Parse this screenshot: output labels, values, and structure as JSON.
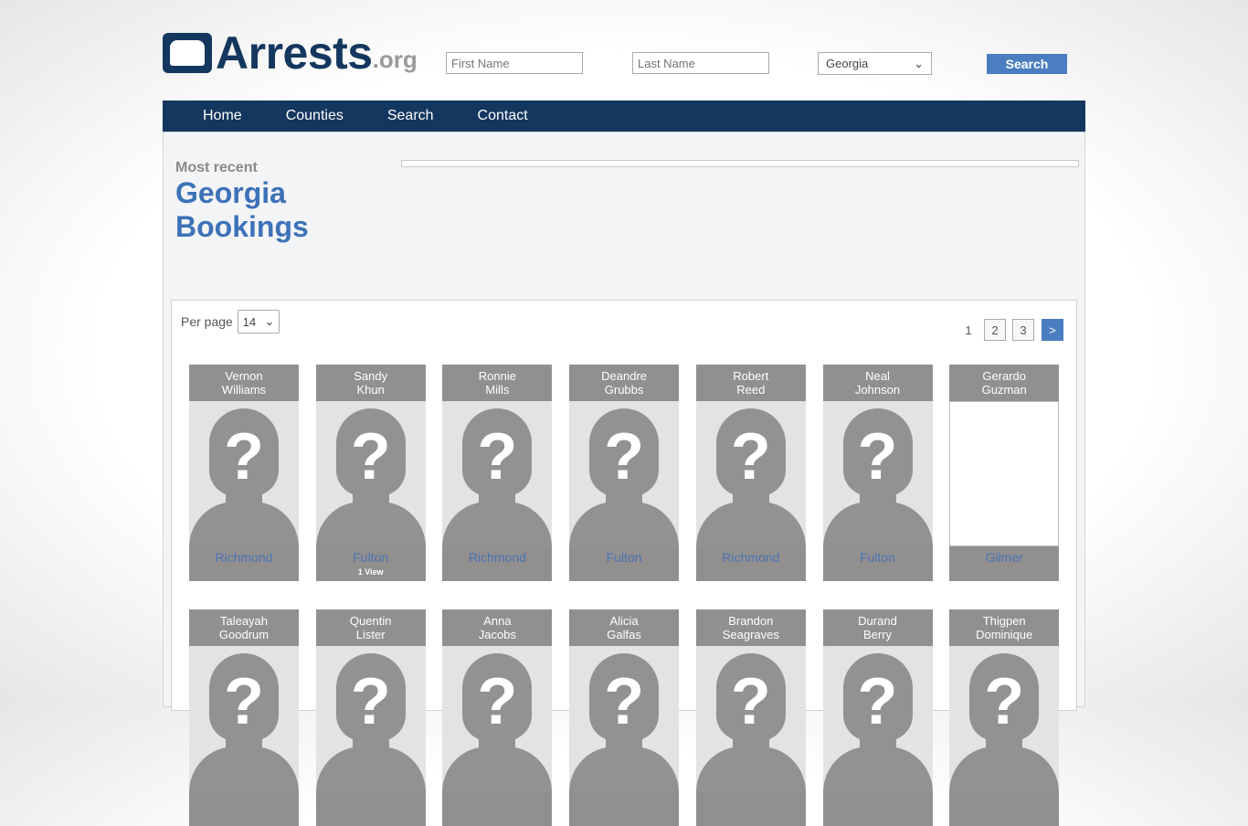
{
  "logo": {
    "text": "Arrests",
    "suffix": ".org"
  },
  "search": {
    "first_placeholder": "First Name",
    "last_placeholder": "Last Name",
    "state": "Georgia",
    "button": "Search"
  },
  "nav": [
    "Home",
    "Counties",
    "Search",
    "Contact"
  ],
  "heading": {
    "eyebrow": "Most recent",
    "line1": "Georgia",
    "line2": "Bookings"
  },
  "per_page": {
    "label": "Per page",
    "value": "14"
  },
  "pagination": {
    "current": "1",
    "pages": [
      "2",
      "3"
    ],
    "next": ">"
  },
  "colors": {
    "brand": "#14375f",
    "accent": "#4a7ec0",
    "title": "#3d72b8"
  },
  "bookings": [
    {
      "first": "Vernon",
      "last": "Williams",
      "county": "Richmond",
      "views": "",
      "photo": "placeholder"
    },
    {
      "first": "Sandy",
      "last": "Khun",
      "county": "Fulton",
      "views": "1 View",
      "photo": "placeholder"
    },
    {
      "first": "Ronnie",
      "last": "Mills",
      "county": "Richmond",
      "views": "",
      "photo": "placeholder"
    },
    {
      "first": "Deandre",
      "last": "Grubbs",
      "county": "Fulton",
      "views": "",
      "photo": "placeholder"
    },
    {
      "first": "Robert",
      "last": "Reed",
      "county": "Richmond",
      "views": "",
      "photo": "placeholder"
    },
    {
      "first": "Neal",
      "last": "Johnson",
      "county": "Fulton",
      "views": "",
      "photo": "placeholder"
    },
    {
      "first": "Gerardo",
      "last": "Guzman",
      "county": "Gilmer",
      "views": "",
      "photo": "broken"
    },
    {
      "first": "Taleayah",
      "last": "Goodrum",
      "county": "",
      "views": "",
      "photo": "placeholder"
    },
    {
      "first": "Quentin",
      "last": "Lister",
      "county": "",
      "views": "",
      "photo": "placeholder"
    },
    {
      "first": "Anna",
      "last": "Jacobs",
      "county": "",
      "views": "",
      "photo": "placeholder"
    },
    {
      "first": "Alicia",
      "last": "Galfas",
      "county": "",
      "views": "",
      "photo": "placeholder"
    },
    {
      "first": "Brandon",
      "last": "Seagraves",
      "county": "",
      "views": "",
      "photo": "placeholder"
    },
    {
      "first": "Durand",
      "last": "Berry",
      "county": "",
      "views": "",
      "photo": "placeholder"
    },
    {
      "first": "Thigpen",
      "last": "Dominique",
      "county": "",
      "views": "",
      "photo": "placeholder"
    }
  ]
}
